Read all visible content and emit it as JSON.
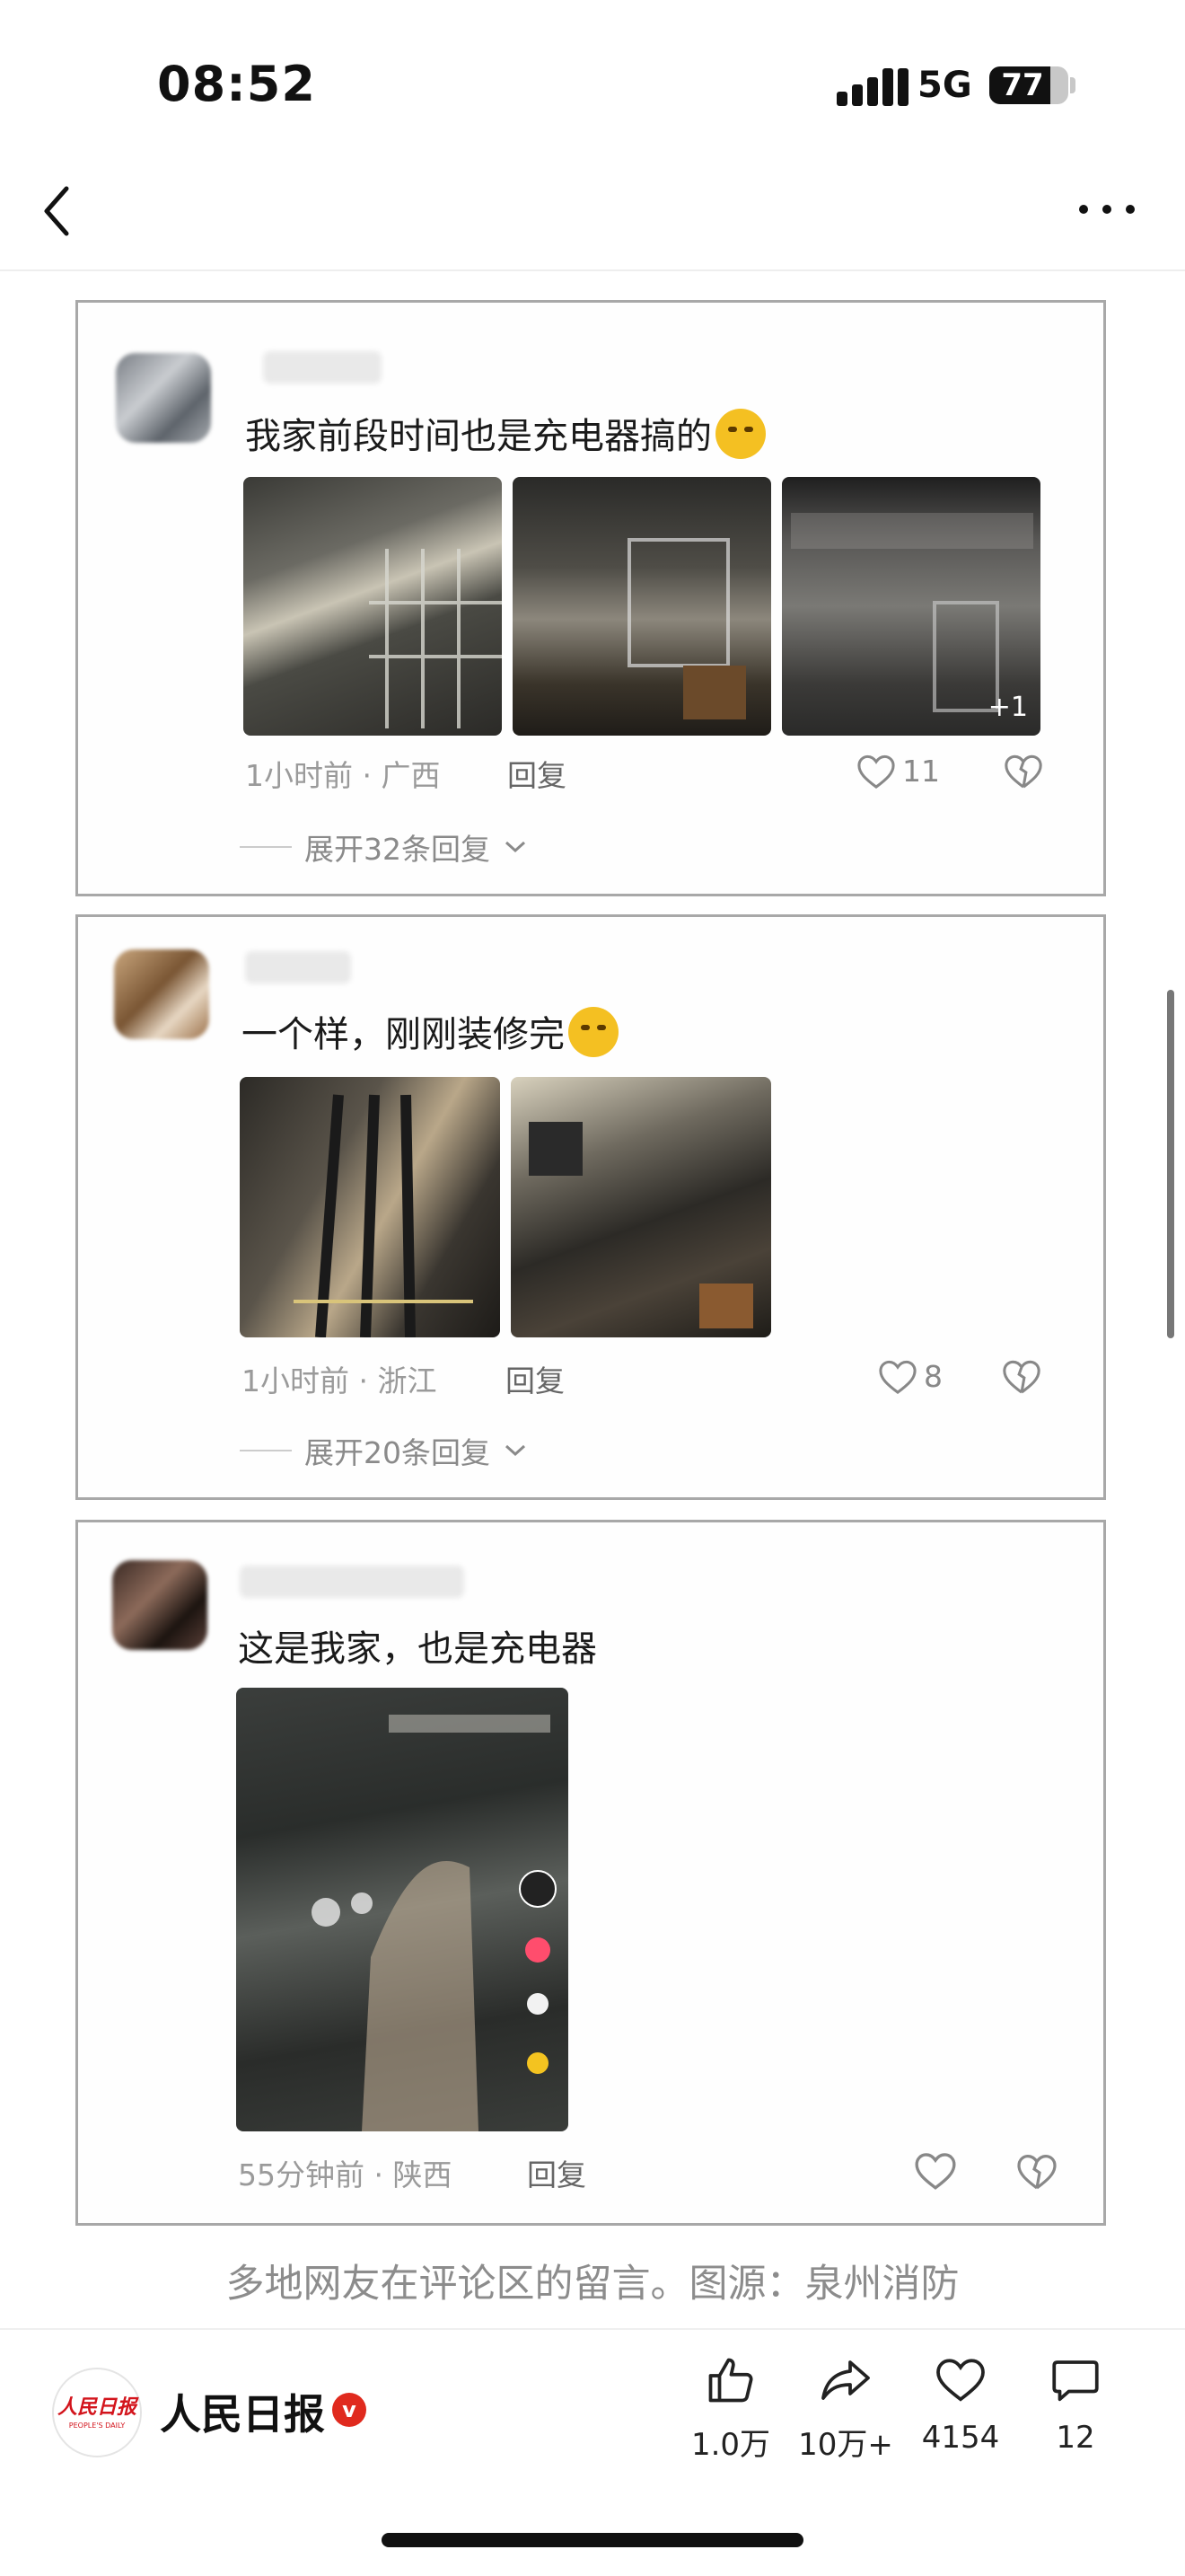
{
  "status_bar": {
    "time": "08:52",
    "network": "5G",
    "battery": "77",
    "battery_level": 0.77
  },
  "nav": {
    "back_icon": "chevron-left-icon",
    "more_icon": "ellipsis-icon"
  },
  "comments": [
    {
      "text": "我家前段时间也是充电器搞的",
      "emoji": "crying-face",
      "photos": [
        "burnt-room-window",
        "burnt-cabinet-room",
        "burnt-wall-ceiling"
      ],
      "extra_photos": "+1",
      "time": "1小时前 · 广西",
      "reply_label": "回复",
      "likes": "11",
      "expand_label": "展开32条回复"
    },
    {
      "text": "一个样，刚刚装修完",
      "emoji": "sad-face",
      "photos": [
        "burnt-pipes-corner",
        "burnt-living-room"
      ],
      "time": "1小时前 · 浙江",
      "reply_label": "回复",
      "likes": "8",
      "expand_label": "展开20条回复"
    },
    {
      "text": "这是我家，也是充电器",
      "photos": [
        "burnt-room-video-screenshot"
      ],
      "time": "55分钟前 · 陕西",
      "reply_label": "回复",
      "likes": ""
    }
  ],
  "caption": "多地网友在评论区的留言。图源：泉州消防",
  "publisher": {
    "name": "人民日报",
    "logo_text": "人民日报",
    "logo_sub": "PEOPLE'S DAILY",
    "verified": "v"
  },
  "actions": [
    {
      "icon": "thumbs-up-icon",
      "label": "1.0万"
    },
    {
      "icon": "share-icon",
      "label": "10万+"
    },
    {
      "icon": "heart-icon",
      "label": "4154"
    },
    {
      "icon": "comment-icon",
      "label": "12"
    }
  ],
  "colors": {
    "accent_red": "#d3141c",
    "verified_red": "#e02a1e",
    "meta_gray": "#9a9a9a",
    "border_gray": "#a8a8a8"
  }
}
